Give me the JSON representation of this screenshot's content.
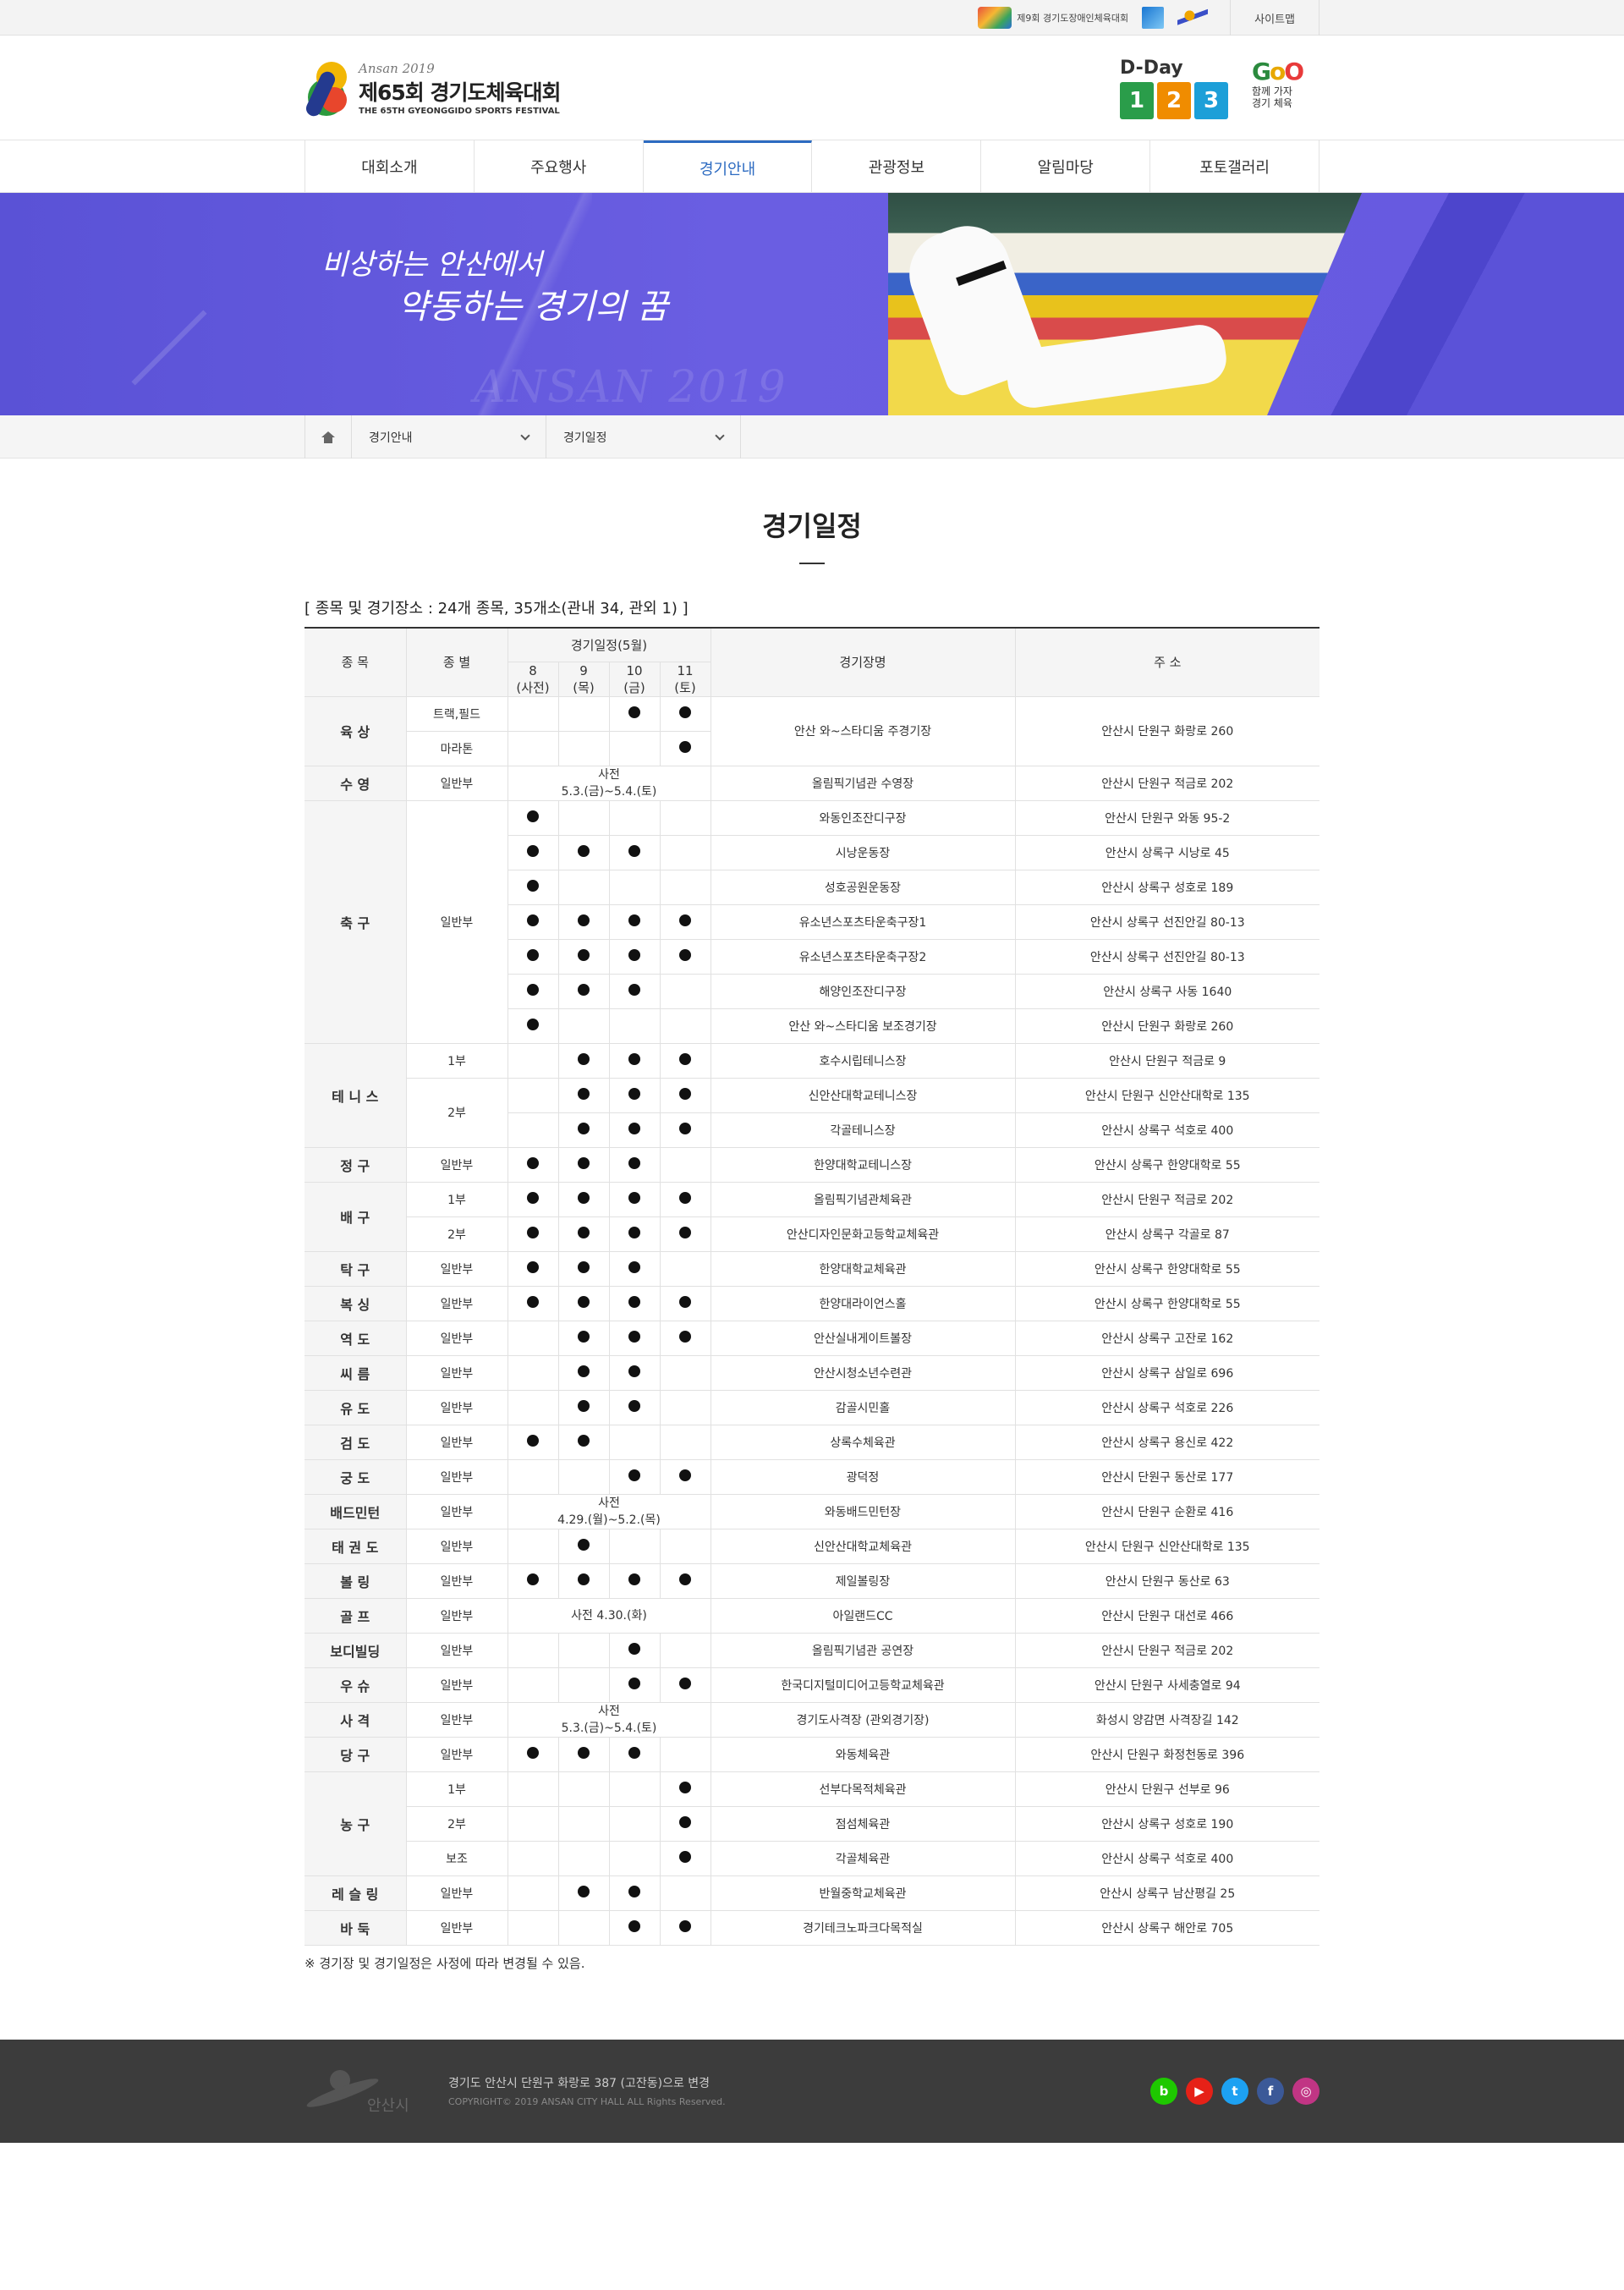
{
  "util": {
    "partner1": "제9회 경기도장애인체육대회",
    "sitemap": "사이트맵"
  },
  "header": {
    "logo_top": "Ansan 2019",
    "logo_main": "제65회 경기도체육대회",
    "logo_sub": "THE 65TH GYEONGGIDO SPORTS FESTIVAL",
    "dday_label": "D-Day",
    "dday_digits": [
      "1",
      "2",
      "3"
    ],
    "dday_colors": [
      "#2a9d4a",
      "#f08c00",
      "#1c9fd8"
    ],
    "go_text": "GoO",
    "go_slogan_1": "함께 가자",
    "go_slogan_2": "경기 체육"
  },
  "gnb": [
    "대회소개",
    "주요행사",
    "경기안내",
    "관광정보",
    "알림마당",
    "포토갤러리"
  ],
  "gnb_active": 2,
  "banner": {
    "slogan_1": "비상하는 안산에서",
    "slogan_2": "약동하는 경기의 꿈",
    "watermark": "ANSAN 2019"
  },
  "location": {
    "depth1": "경기안내",
    "depth2": "경기일정"
  },
  "page": {
    "title": "경기일정",
    "summary": "[ 종목 및 경기장소 : 24개 종목, 35개소(관내 34, 관외 1) ]",
    "note": "※ 경기장 및 경기일정은 사정에 따라 변경될 수 있음."
  },
  "table": {
    "headers": {
      "sport": "종 목",
      "division": "종 별",
      "schedule": "경기일정(5월)",
      "days": [
        {
          "num": "8",
          "dow": "(사전)"
        },
        {
          "num": "9",
          "dow": "(목)"
        },
        {
          "num": "10",
          "dow": "(금)"
        },
        {
          "num": "11",
          "dow": "(토)"
        }
      ],
      "venue": "경기장명",
      "address": "주 소"
    },
    "groups": [
      {
        "sport": "육 상",
        "rows": [
          {
            "division": "트랙,필드",
            "days": [
              0,
              0,
              1,
              1
            ],
            "venue": "안산 와~스타디움 주경기장",
            "address": "안산시 단원구 화랑로 260"
          },
          {
            "division": "마라톤",
            "days": [
              0,
              0,
              0,
              1
            ]
          }
        ],
        "venue_span": true
      },
      {
        "sport": "수 영",
        "rows": [
          {
            "division": "일반부",
            "pre": "사전\n5.3.(금)~5.4.(토)",
            "venue": "올림픽기념관 수영장",
            "address": "안산시 단원구 적금로 202"
          }
        ]
      },
      {
        "sport": "축 구",
        "div_span": "일반부",
        "rows": [
          {
            "days": [
              1,
              0,
              0,
              0
            ],
            "venue": "와동인조잔디구장",
            "address": "안산시 단원구 와동 95-2"
          },
          {
            "days": [
              1,
              1,
              1,
              0
            ],
            "venue": "시낭운동장",
            "address": "안산시 상록구 시낭로 45"
          },
          {
            "days": [
              1,
              0,
              0,
              0
            ],
            "venue": "성호공원운동장",
            "address": "안산시 상록구 성호로 189"
          },
          {
            "days": [
              1,
              1,
              1,
              1
            ],
            "venue": "유소년스포츠타운축구장1",
            "address": "안산시 상록구 선진안길 80-13"
          },
          {
            "days": [
              1,
              1,
              1,
              1
            ],
            "venue": "유소년스포츠타운축구장2",
            "address": "안산시 상록구 선진안길 80-13"
          },
          {
            "days": [
              1,
              1,
              1,
              0
            ],
            "venue": "해양인조잔디구장",
            "address": "안산시 상록구 사동 1640"
          },
          {
            "days": [
              1,
              0,
              0,
              0
            ],
            "venue": "안산 와~스타디움 보조경기장",
            "address": "안산시 단원구 화랑로 260"
          }
        ]
      },
      {
        "sport": "테 니 스",
        "rows": [
          {
            "division": "1부",
            "days": [
              0,
              1,
              1,
              1
            ],
            "venue": "호수시립테니스장",
            "address": "안산시 단원구 적금로 9"
          },
          {
            "division": "2부",
            "div_rows": 2,
            "days": [
              0,
              1,
              1,
              1
            ],
            "venue": "신안산대학교테니스장",
            "address": "안산시 단원구 신안산대학로 135"
          },
          {
            "days": [
              0,
              1,
              1,
              1
            ],
            "venue": "각골테니스장",
            "address": "안산시 상록구 석호로 400"
          }
        ]
      },
      {
        "sport": "정 구",
        "rows": [
          {
            "division": "일반부",
            "days": [
              1,
              1,
              1,
              0
            ],
            "venue": "한양대학교테니스장",
            "address": "안산시 상록구 한양대학로 55"
          }
        ]
      },
      {
        "sport": "배 구",
        "rows": [
          {
            "division": "1부",
            "days": [
              1,
              1,
              1,
              1
            ],
            "venue": "올림픽기념관체육관",
            "address": "안산시 단원구 적금로 202"
          },
          {
            "division": "2부",
            "days": [
              1,
              1,
              1,
              1
            ],
            "venue": "안산디자인문화고등학교체육관",
            "address": "안산시 상록구 각골로 87"
          }
        ]
      },
      {
        "sport": "탁 구",
        "rows": [
          {
            "division": "일반부",
            "days": [
              1,
              1,
              1,
              0
            ],
            "venue": "한양대학교체육관",
            "address": "안산시 상록구 한양대학로 55"
          }
        ]
      },
      {
        "sport": "복 싱",
        "rows": [
          {
            "division": "일반부",
            "days": [
              1,
              1,
              1,
              1
            ],
            "venue": "한양대라이언스홀",
            "address": "안산시 상록구 한양대학로 55"
          }
        ]
      },
      {
        "sport": "역 도",
        "rows": [
          {
            "division": "일반부",
            "days": [
              0,
              1,
              1,
              1
            ],
            "venue": "안산실내게이트볼장",
            "address": "안산시 상록구 고잔로 162"
          }
        ]
      },
      {
        "sport": "씨 름",
        "rows": [
          {
            "division": "일반부",
            "days": [
              0,
              1,
              1,
              0
            ],
            "venue": "안산시청소년수련관",
            "address": "안산시 상록구 삼일로 696"
          }
        ]
      },
      {
        "sport": "유 도",
        "rows": [
          {
            "division": "일반부",
            "days": [
              0,
              1,
              1,
              0
            ],
            "venue": "감골시민홀",
            "address": "안산시 상록구 석호로 226"
          }
        ]
      },
      {
        "sport": "검 도",
        "rows": [
          {
            "division": "일반부",
            "days": [
              1,
              1,
              0,
              0
            ],
            "venue": "상록수체육관",
            "address": "안산시 상록구 용신로 422"
          }
        ]
      },
      {
        "sport": "궁 도",
        "rows": [
          {
            "division": "일반부",
            "days": [
              0,
              0,
              1,
              1
            ],
            "venue": "광덕정",
            "address": "안산시 단원구 동산로 177"
          }
        ]
      },
      {
        "sport": "배드민턴",
        "rows": [
          {
            "division": "일반부",
            "pre": "사전\n4.29.(월)~5.2.(목)",
            "venue": "와동배드민턴장",
            "address": "안산시 단원구 순환로 416"
          }
        ]
      },
      {
        "sport": "태 권 도",
        "rows": [
          {
            "division": "일반부",
            "days": [
              0,
              1,
              0,
              0
            ],
            "venue": "신안산대학교체육관",
            "address": "안산시 단원구 신안산대학로 135"
          }
        ]
      },
      {
        "sport": "볼 링",
        "rows": [
          {
            "division": "일반부",
            "days": [
              1,
              1,
              1,
              1
            ],
            "venue": "제일볼링장",
            "address": "안산시 단원구 동산로 63"
          }
        ]
      },
      {
        "sport": "골 프",
        "rows": [
          {
            "division": "일반부",
            "pre": "사전 4.30.(화)",
            "venue": "아일랜드CC",
            "address": "안산시 단원구 대선로 466"
          }
        ]
      },
      {
        "sport": "보디빌딩",
        "rows": [
          {
            "division": "일반부",
            "days": [
              0,
              0,
              1,
              0
            ],
            "venue": "올림픽기념관 공연장",
            "address": "안산시 단원구 적금로 202"
          }
        ]
      },
      {
        "sport": "우 슈",
        "rows": [
          {
            "division": "일반부",
            "days": [
              0,
              0,
              1,
              1
            ],
            "venue": "한국디지털미디어고등학교체육관",
            "address": "안산시 단원구 사세충열로 94"
          }
        ]
      },
      {
        "sport": "사 격",
        "rows": [
          {
            "division": "일반부",
            "pre": "사전\n5.3.(금)~5.4.(토)",
            "venue": "경기도사격장 (관외경기장)",
            "address": "화성시 양감면 사격장길 142"
          }
        ]
      },
      {
        "sport": "당 구",
        "rows": [
          {
            "division": "일반부",
            "days": [
              1,
              1,
              1,
              0
            ],
            "venue": "와동체육관",
            "address": "안산시 단원구 화정천동로 396"
          }
        ]
      },
      {
        "sport": "농 구",
        "rows": [
          {
            "division": "1부",
            "days": [
              0,
              0,
              0,
              1
            ],
            "venue": "선부다목적체육관",
            "address": "안산시 단원구 선부로 96"
          },
          {
            "division": "2부",
            "days": [
              0,
              0,
              0,
              1
            ],
            "venue": "점섬체육관",
            "address": "안산시 상록구 성호로 190"
          },
          {
            "division": "보조",
            "days": [
              0,
              0,
              0,
              1
            ],
            "venue": "각골체육관",
            "address": "안산시 상록구 석호로 400"
          }
        ]
      },
      {
        "sport": "레 슬 링",
        "rows": [
          {
            "division": "일반부",
            "days": [
              0,
              1,
              1,
              0
            ],
            "venue": "반월중학교체육관",
            "address": "안산시 상록구 남산평길 25"
          }
        ]
      },
      {
        "sport": "바 둑",
        "rows": [
          {
            "division": "일반부",
            "days": [
              0,
              0,
              1,
              1
            ],
            "venue": "경기테크노파크다목적실",
            "address": "안산시 상록구 해안로 705"
          }
        ]
      }
    ]
  },
  "footer": {
    "city": "안산시",
    "address": "경기도 안산시 단원구 화랑로 387 (고잔동)으로 변경",
    "copyright": "COPYRIGHT© 2019 ANSAN CITY HALL ALL Rights Reserved.",
    "sns": [
      {
        "name": "blog-icon",
        "glyph": "b",
        "color": "#1ec800"
      },
      {
        "name": "youtube-icon",
        "glyph": "▶",
        "color": "#e62117"
      },
      {
        "name": "twitter-icon",
        "glyph": "t",
        "color": "#1da1f2"
      },
      {
        "name": "facebook-icon",
        "glyph": "f",
        "color": "#3b5998"
      },
      {
        "name": "instagram-icon",
        "glyph": "◎",
        "color": "#c13584"
      }
    ]
  }
}
